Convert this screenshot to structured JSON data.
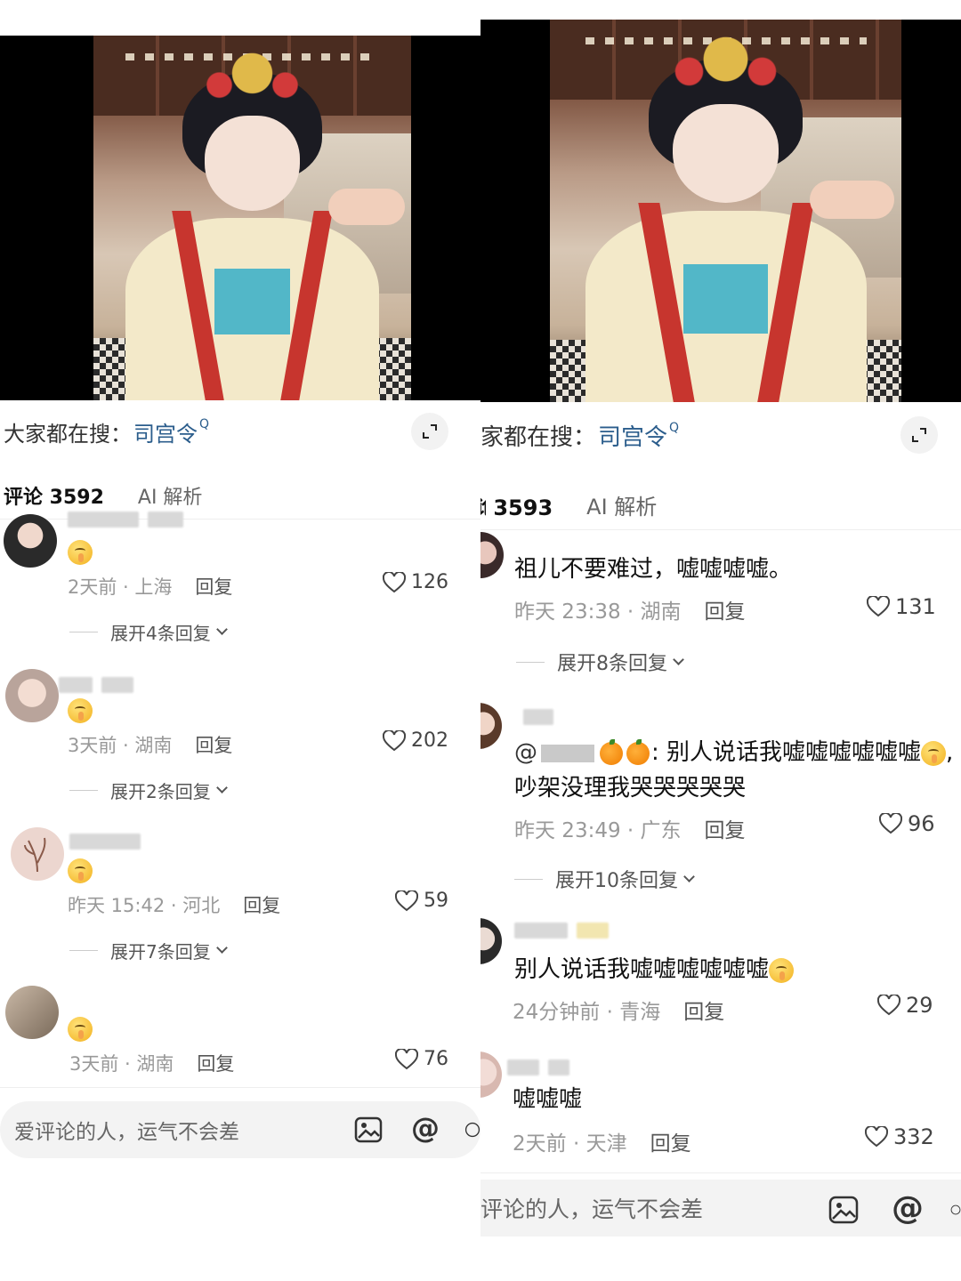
{
  "left": {
    "search": {
      "prefix": "大家都在搜：",
      "term": "司宫令",
      "q": "Q"
    },
    "tabs": {
      "comments": "评论 3592",
      "ai": "AI 解析"
    },
    "comments": [
      {
        "text_emoji": true,
        "time": "2天前 · 上海",
        "reply": "回复",
        "likes": "126",
        "expand": "展开4条回复"
      },
      {
        "text_emoji": true,
        "time": "3天前 · 湖南",
        "reply": "回复",
        "likes": "202",
        "expand": "展开2条回复"
      },
      {
        "text_emoji": true,
        "time": "昨天 15:42 · 河北",
        "reply": "回复",
        "likes": "59",
        "expand": "展开7条回复"
      },
      {
        "text_emoji": true,
        "time": "3天前 · 湖南",
        "reply": "回复",
        "likes": "76"
      }
    ],
    "input": {
      "placeholder": "爱评论的人，运气不会差"
    }
  },
  "right": {
    "search": {
      "prefix": "家都在搜：",
      "term": "司宫令",
      "q": "Q"
    },
    "tabs": {
      "comments": "3593",
      "ai": "AI 解析"
    },
    "comments": [
      {
        "text": "祖儿不要难过，嘘嘘嘘嘘。",
        "time": "昨天 23:38 · 湖南",
        "reply": "回复",
        "likes": "131",
        "expand": "展开8条回复"
      },
      {
        "text_line1": ": 别人说话我嘘嘘嘘嘘嘘嘘",
        "text_line2": "吵架没理我哭哭哭哭哭",
        "time": "昨天 23:49 · 广东",
        "reply": "回复",
        "likes": "96",
        "expand": "展开10条回复"
      },
      {
        "text": "别人说话我嘘嘘嘘嘘嘘嘘",
        "time": "24分钟前 · 青海",
        "reply": "回复",
        "likes": "29"
      },
      {
        "text": "嘘嘘嘘",
        "time": "2天前 · 天津",
        "reply": "回复",
        "likes": "332"
      }
    ],
    "input": {
      "placeholder": "评论的人，运气不会差"
    }
  },
  "colors": {
    "link": "#2b5d8c",
    "muted": "#999999",
    "accent_red": "#c7352e"
  },
  "icons": [
    "expand-icon",
    "heart-icon",
    "image-icon",
    "at-icon",
    "chevron-down-icon",
    "search-icon"
  ]
}
